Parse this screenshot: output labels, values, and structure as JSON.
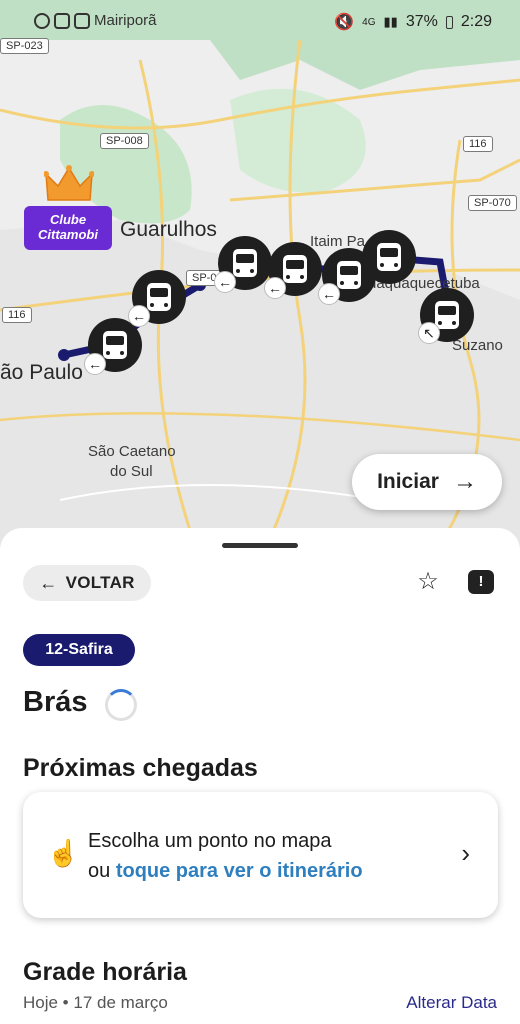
{
  "status_bar": {
    "location_text": "Mairiporã",
    "battery": "37%",
    "time": "2:29",
    "network": "4G"
  },
  "map": {
    "labels": {
      "guarulhos": "Guarulhos",
      "sao_paulo": "ão Paulo",
      "sao_caetano_line1": "São Caetano",
      "sao_caetano_line2": "do Sul",
      "itaim": "Itaim Pa",
      "itaquaquecetuba": "uaquaquecetuba",
      "suzano": "Suzano"
    },
    "shields": {
      "sp023": "SP-023",
      "sp008": "SP-008",
      "r116a": "116",
      "r116b": "116",
      "sp070": "SP-070",
      "sp0x": "SP-0"
    },
    "clube_badge": "Clube Cittamobi",
    "iniciar_label": "Iniciar",
    "route_color": "#1a1a6e"
  },
  "sheet": {
    "back_label": "VOLTAR",
    "line_badge": "12-Safira",
    "line_color": "#1a1a6e",
    "station_name": "Brás",
    "next_arrivals_title": "Próximas chegadas",
    "card_line1": "Escolha um ponto no mapa",
    "card_line2_prefix": "ou ",
    "card_line2_link": "toque para ver o itinerário",
    "schedule_title": "Grade horária",
    "date_text": "Hoje • 17 de março",
    "change_date_label": "Alterar Data"
  }
}
